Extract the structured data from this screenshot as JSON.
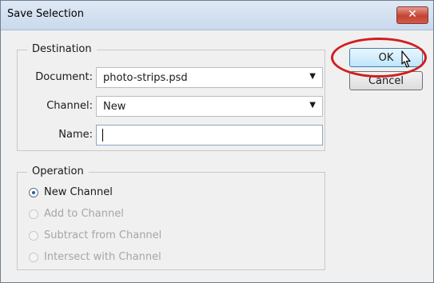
{
  "dialog": {
    "title": "Save Selection",
    "close_glyph": "✕"
  },
  "destination": {
    "legend": "Destination",
    "document_label": "Document:",
    "document_value": "photo-strips.psd",
    "channel_label": "Channel:",
    "channel_value": "New",
    "name_label": "Name:",
    "name_value": ""
  },
  "operation": {
    "legend": "Operation",
    "options": [
      {
        "label": "New Channel",
        "checked": true,
        "enabled": true
      },
      {
        "label": "Add to Channel",
        "checked": false,
        "enabled": false
      },
      {
        "label": "Subtract from Channel",
        "checked": false,
        "enabled": false
      },
      {
        "label": "Intersect with Channel",
        "checked": false,
        "enabled": false
      }
    ]
  },
  "buttons": {
    "ok": "OK",
    "cancel": "Cancel"
  },
  "icons": {
    "dropdown_arrow": "chevron-down-icon",
    "cursor": "mouse-pointer-icon"
  },
  "colors": {
    "highlight": "#d11e1e",
    "close": "#c44333"
  }
}
